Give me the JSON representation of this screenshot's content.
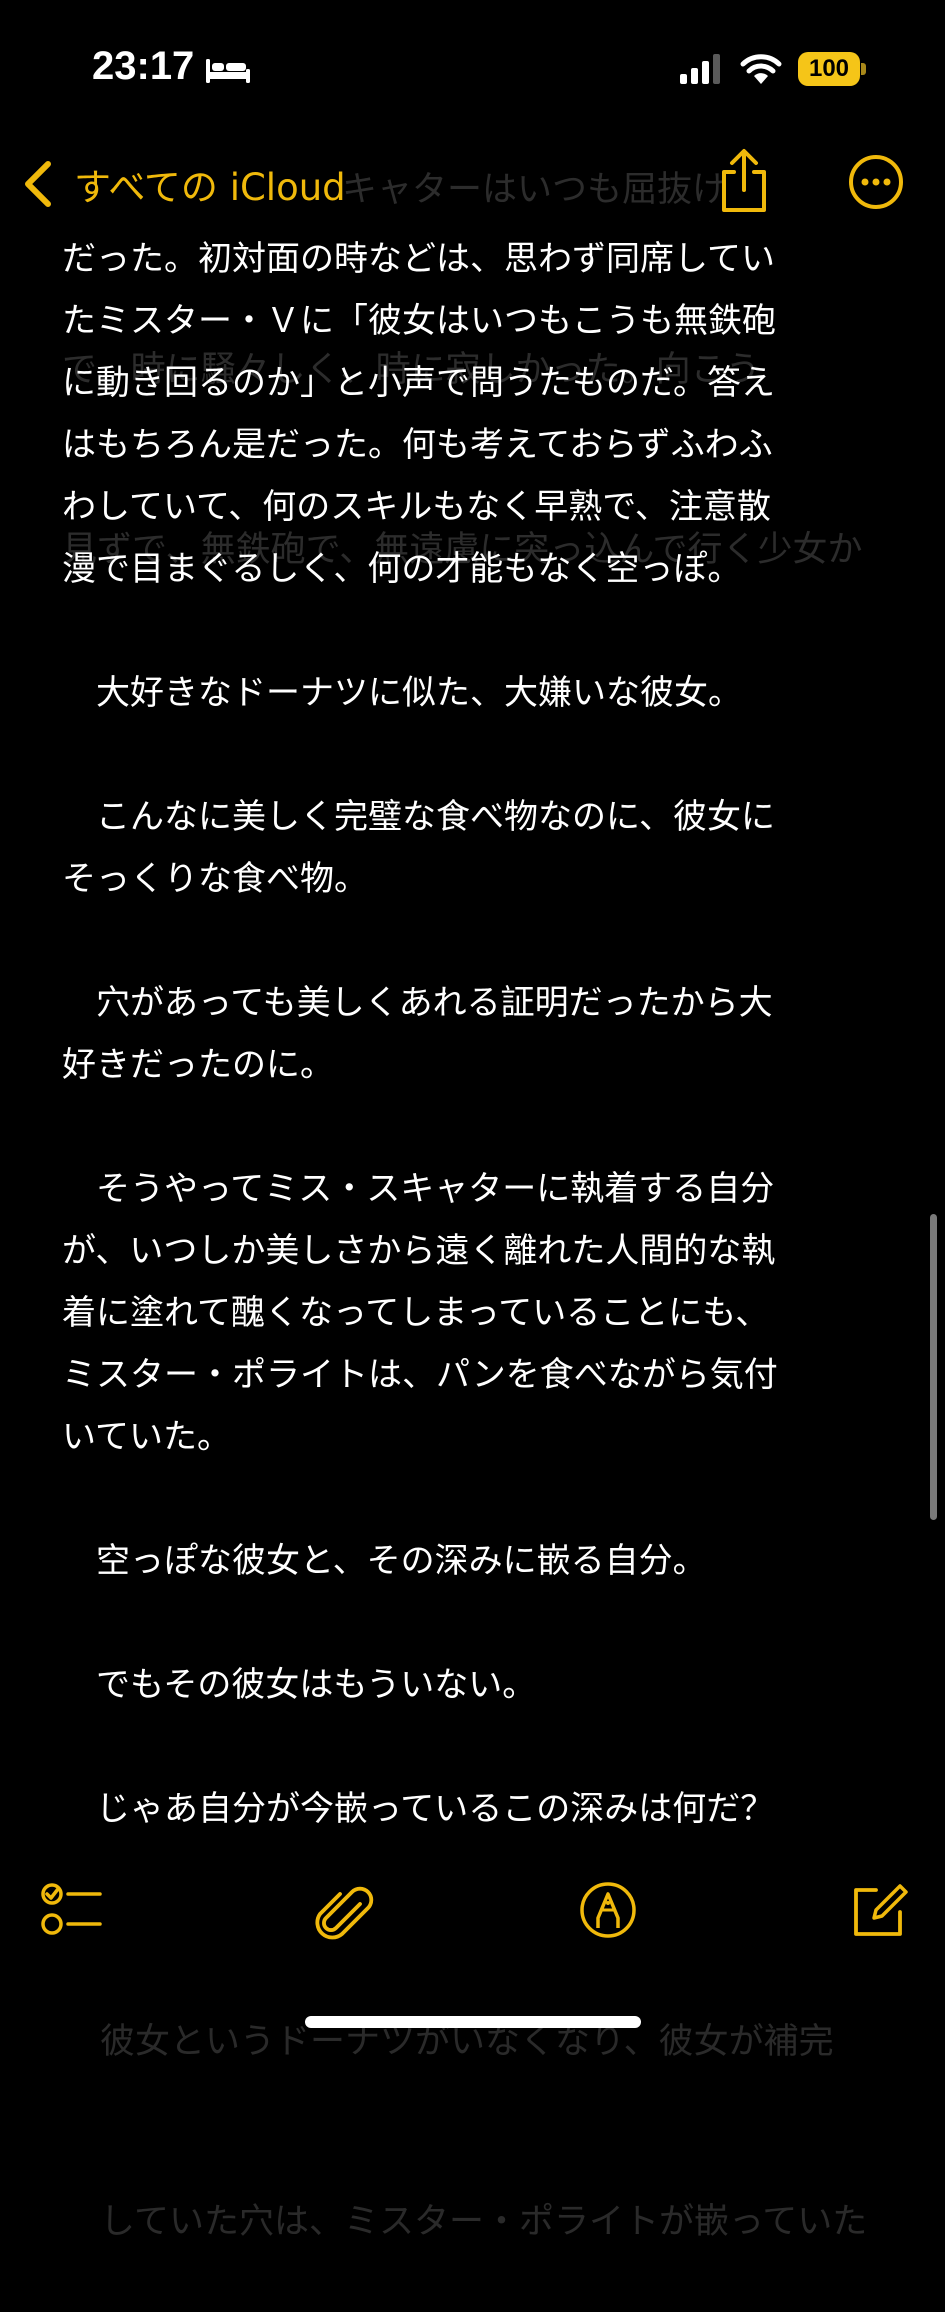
{
  "status_bar": {
    "time": "23:17",
    "battery": "100",
    "icons": [
      "bed-icon",
      "cellular-signal-icon",
      "wifi-icon",
      "battery-icon"
    ]
  },
  "nav": {
    "back_label": "すべての iCloud",
    "icons": [
      "chevron-left-icon",
      "share-icon",
      "more-icon"
    ]
  },
  "faint_top": {
    "lines": [
      "　　　　　　　　キャターはいつも屈抜け",
      "で、時に騒々しく、時に寂しかった。向こう",
      "見ずで、無鉄砲で、無遠慮に突っ込んで行く少女か"
    ]
  },
  "note": {
    "paragraphs": [
      {
        "lines": [
          "だった。初対面の時などは、思わず同席してい",
          "たミスター・Ｖに「彼女はいつもこうも無鉄砲",
          "に動き回るのか」と小声で問うたものだ。答え",
          "はもちろん是だった。何も考えておらずふわふ",
          "わしていて、何のスキルもなく早熟で、注意散",
          "漫で目まぐるしく、何の才能もなく空っぽ。"
        ]
      },
      {
        "lines": [
          "　大好きなドーナツに似た、大嫌いな彼女。"
        ]
      },
      {
        "lines": [
          "　こんなに美しく完璧な食べ物なのに、彼女に",
          "そっくりな食べ物。"
        ]
      },
      {
        "lines": [
          "　穴があっても美しくあれる証明だったから大",
          "好きだったのに。"
        ]
      },
      {
        "lines": [
          "　そうやってミス・スキャターに執着する自分",
          "が、いつしか美しさから遠く離れた人間的な執",
          "着に塗れて醜くなってしまっていることにも、",
          "ミスター・ポライトは、パンを食べながら気付",
          "いていた。"
        ]
      },
      {
        "lines": [
          "　空っぽな彼女と、その深みに嵌る自分。"
        ]
      },
      {
        "lines": [
          "　でもその彼女はもういない。"
        ]
      },
      {
        "lines": [
          "　じゃあ自分が今嵌っているこの深みは何だ？"
        ]
      }
    ]
  },
  "faint_bottom": {
    "lines": [
      "彼女というドーナツがいなくなり、彼女が補完",
      "していた穴は、ミスター・ポライトが嵌っていた"
    ]
  },
  "toolbar": {
    "icons": [
      "checklist-icon",
      "paperclip-icon",
      "markup-pen-icon",
      "compose-icon"
    ]
  },
  "colors": {
    "accent": "#f0b90b",
    "background": "#000000",
    "text": "#ffffff",
    "battery": "#f5c518"
  }
}
